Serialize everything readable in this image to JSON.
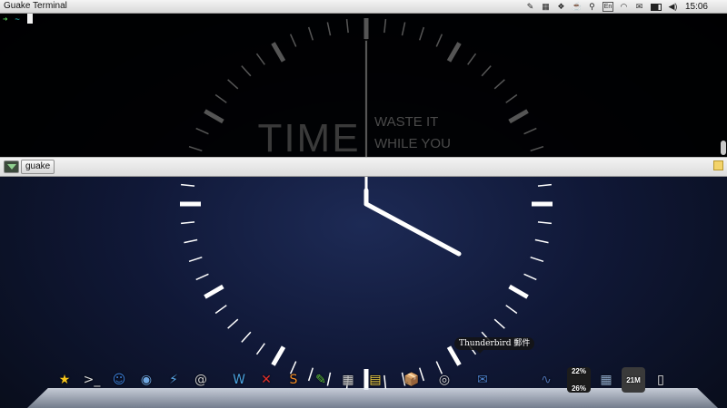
{
  "menubar": {
    "app_title": "Guake Terminal",
    "time": "15:06",
    "tray_icons": [
      "edit-icon",
      "grid-icon",
      "dropbox-icon",
      "cup-icon",
      "search-icon",
      "input-method-icon",
      "wifi-icon",
      "mail-icon",
      "battery-icon",
      "volume-icon",
      "apple-icon"
    ],
    "input_method_label": "En"
  },
  "terminal": {
    "prompt_arrow": "➜",
    "prompt_dir": "~",
    "wallpaper_word": "TIME",
    "wallpaper_line1": "WASTE IT",
    "wallpaper_line2": "WHILE YOU"
  },
  "tabbar": {
    "tabs": [
      {
        "label": "guake"
      }
    ]
  },
  "tooltip": {
    "text": "Thunderbird 郵件"
  },
  "dock": {
    "items": [
      {
        "name": "favorites",
        "icon": "star-icon",
        "glyph": "★",
        "color": "#f7c51b"
      },
      {
        "name": "terminal",
        "icon": "terminal-icon",
        "glyph": ">_",
        "color": "#dddddd"
      },
      {
        "name": "finder",
        "icon": "finder-icon",
        "glyph": "☺",
        "color": "#3b7fd9"
      },
      {
        "name": "chrome",
        "icon": "chrome-icon",
        "glyph": "◉",
        "color": "#6fa6e0"
      },
      {
        "name": "thunder",
        "icon": "lightning-icon",
        "glyph": "⚡",
        "color": "#5aa6e8"
      },
      {
        "name": "mail-stamp",
        "icon": "at-icon",
        "glyph": "@",
        "color": "#c9c9c9"
      },
      {
        "name": "wps",
        "icon": "wps-icon",
        "glyph": "W",
        "color": "#4aa3e0"
      },
      {
        "name": "xmind",
        "icon": "xmind-icon",
        "glyph": "✕",
        "color": "#e0302b"
      },
      {
        "name": "sublime",
        "icon": "sublime-icon",
        "glyph": "S",
        "color": "#f08a24"
      },
      {
        "name": "notes-editor",
        "icon": "edit-icon",
        "glyph": "✎",
        "color": "#5fc23a"
      },
      {
        "name": "calculator",
        "icon": "calculator-icon",
        "glyph": "▦",
        "color": "#cfcfcf"
      },
      {
        "name": "stickies",
        "icon": "sticky-note-icon",
        "glyph": "▤",
        "color": "#f5d442"
      },
      {
        "name": "installer",
        "icon": "package-icon",
        "glyph": "📦",
        "color": "#c8a878"
      },
      {
        "name": "dvd-player",
        "icon": "disc-icon",
        "glyph": "◎",
        "color": "#d9d9d9"
      },
      {
        "name": "thunderbird",
        "icon": "thunderbird-icon",
        "glyph": "✉",
        "color": "#4c7fc9"
      },
      {
        "name": "activity-monitor",
        "icon": "monitor-icon",
        "glyph": "∿",
        "color": "#4b6fb0"
      },
      {
        "name": "cpu-widget",
        "icon": "gauge-icon",
        "badge1": "22%",
        "badge2": "26%",
        "glyph": "",
        "color": "#1c1c1c"
      },
      {
        "name": "spaces",
        "icon": "spaces-icon",
        "glyph": "▦",
        "color": "#8faacc"
      },
      {
        "name": "memory-widget",
        "icon": "memory-icon",
        "badge1": "21M",
        "glyph": "",
        "color": "#3a3a3a"
      },
      {
        "name": "document",
        "icon": "document-icon",
        "glyph": "▯",
        "color": "#f2f2f2"
      }
    ]
  },
  "colors": {
    "wallpaper": "#101837",
    "terminal_bg": "#000000",
    "prompt_green": "#5fd35f",
    "prompt_cyan": "#2ec4c4"
  }
}
